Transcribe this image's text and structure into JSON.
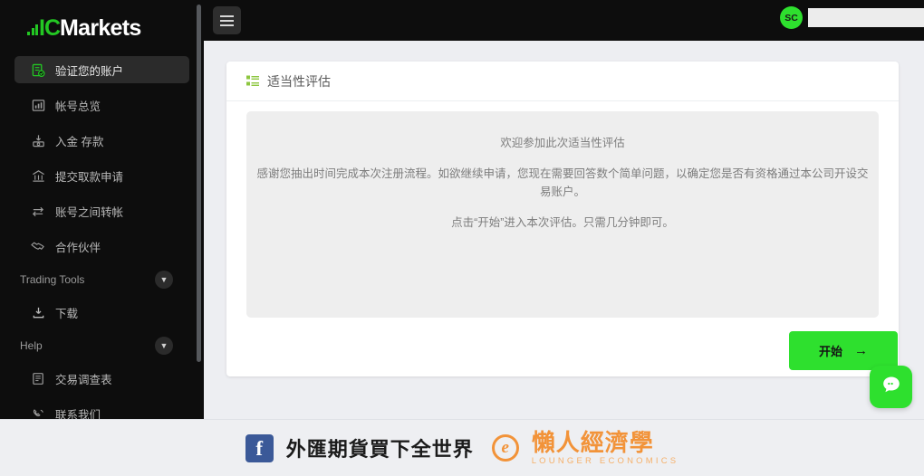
{
  "brand": {
    "logo_ic": "IC",
    "logo_markets": "Markets",
    "accent_green": "#2ee02e",
    "sidebar_bg": "#0d0d0d",
    "page_bg": "#edeef2"
  },
  "sidebar": {
    "items": [
      {
        "label": "验证您的账户",
        "icon": "verify-account-icon",
        "active": true
      },
      {
        "label": "帐号总览",
        "icon": "account-overview-icon",
        "active": false
      },
      {
        "label": "入金 存款",
        "icon": "deposit-icon",
        "active": false
      },
      {
        "label": "提交取款申请",
        "icon": "withdrawal-icon",
        "active": false
      },
      {
        "label": "账号之间转帐",
        "icon": "transfer-icon",
        "active": false
      },
      {
        "label": "合作伙伴",
        "icon": "partners-icon",
        "active": false
      }
    ],
    "sections": [
      {
        "label": "Trading Tools",
        "chevron": "chevron-down-icon",
        "items": [
          {
            "label": "下载",
            "icon": "download-icon"
          }
        ]
      },
      {
        "label": "Help",
        "chevron": "chevron-down-icon",
        "items": [
          {
            "label": "交易调查表",
            "icon": "survey-icon"
          },
          {
            "label": "联系我们",
            "icon": "contact-us-icon"
          }
        ]
      }
    ]
  },
  "topbar": {
    "menu_icon": "hamburger-menu-icon",
    "avatar_initials": "SC",
    "username_value": ""
  },
  "card": {
    "icon": "list-icon",
    "title": "适当性评估",
    "panel": {
      "heading": "欢迎参加此次适当性评估",
      "body": "感谢您抽出时间完成本次注册流程。如欲继续申请，您现在需要回答数个简单问题，以确定您是否有资格通过本公司开设交易账户。",
      "footnote": "点击“开始”进入本次评估。只需几分钟即可。"
    },
    "start_button": {
      "label": "开始",
      "arrow": "→",
      "icon": "arrow-right-icon"
    }
  },
  "chat_widget": {
    "icon": "chat-bubble-icon"
  },
  "footer": {
    "facebook_icon": "facebook-icon",
    "facebook_glyph": "f",
    "facebook_page": "外匯期貨買下全世界",
    "lounger_icon": "lounger-economics-logo-icon",
    "lounger_glyph": "e",
    "lounger_cn": "懶人經濟學",
    "lounger_en": "LOUNGER ECONOMICS"
  }
}
